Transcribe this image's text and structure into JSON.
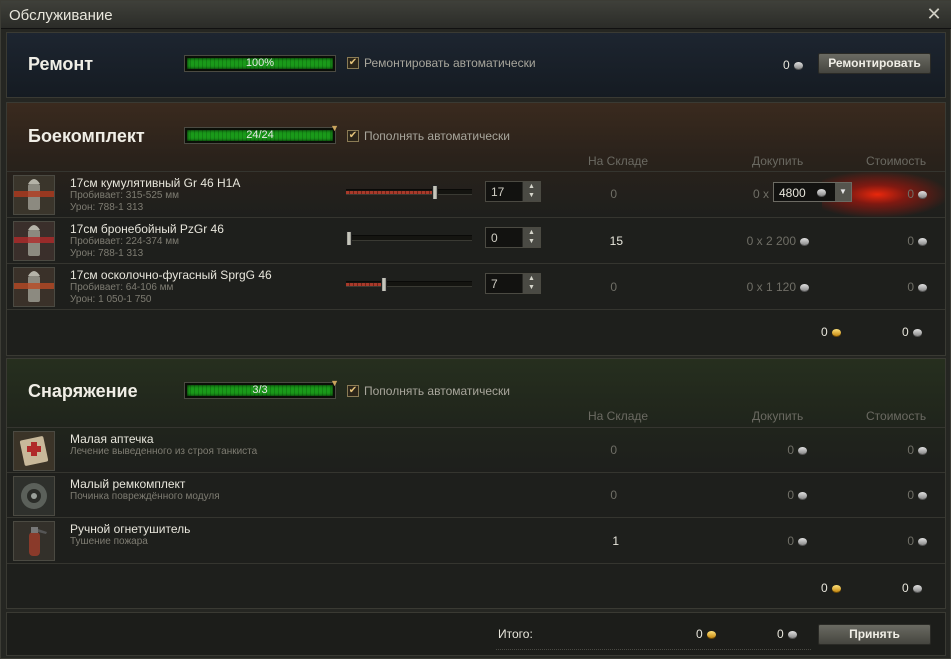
{
  "window": {
    "title": "Обслуживание"
  },
  "repair": {
    "title": "Ремонт",
    "progress_text": "100%",
    "progress": 1.0,
    "auto_label": "Ремонтировать автоматически",
    "cost": "0",
    "button": "Ремонтировать"
  },
  "ammo": {
    "title": "Боекомплект",
    "progress_text": "24/24",
    "progress": 1.0,
    "auto_label": "Пополнять автоматически",
    "col_stock": "На Складе",
    "col_buy": "Докупить",
    "col_cost": "Стоимость",
    "rows": [
      {
        "name": "17см кумулятивный Gr 46 H1A",
        "pen": "Пробивает: 315-525 мм",
        "dmg": "Урон: 788-1 313",
        "count": "17",
        "slider": 0.708,
        "stock": "0",
        "buy_prefix": "0 x",
        "buy_price": "4800",
        "cost": "0",
        "color": "#b03a1e"
      },
      {
        "name": "17см бронебойный PzGr 46",
        "pen": "Пробивает: 224-374 мм",
        "dmg": "Урон: 788-1 313",
        "count": "0",
        "slider": 0.0,
        "stock": "15",
        "buy": "0 x 2 200",
        "cost": "0",
        "color": "#b02a2a"
      },
      {
        "name": "17см осколочно-фугасный SprgG 46",
        "pen": "Пробивает: 64-106 мм",
        "dmg": "Урон: 1 050-1 750",
        "count": "7",
        "slider": 0.292,
        "stock": "0",
        "buy": "0 x 1 120",
        "cost": "0",
        "color": "#b84a24"
      }
    ],
    "total_gold": "0",
    "total_credits": "0"
  },
  "equip": {
    "title": "Снаряжение",
    "progress_text": "3/3",
    "progress": 1.0,
    "auto_label": "Пополнять автоматически",
    "col_stock": "На Складе",
    "col_buy": "Докупить",
    "col_cost": "Стоимость",
    "rows": [
      {
        "name": "Малая аптечка",
        "desc": "Лечение выведенного из строя танкиста",
        "stock": "0",
        "buy": "0",
        "cost": "0"
      },
      {
        "name": "Малый ремкомплект",
        "desc": "Починка повреждённого модуля",
        "stock": "0",
        "buy": "0",
        "cost": "0"
      },
      {
        "name": "Ручной огнетушитель",
        "desc": "Тушение пожара",
        "stock": "1",
        "buy": "0",
        "cost": "0"
      }
    ],
    "total_gold": "0",
    "total_credits": "0"
  },
  "footer": {
    "total_label": "Итого:",
    "gold": "0",
    "credits": "0",
    "accept": "Принять"
  }
}
